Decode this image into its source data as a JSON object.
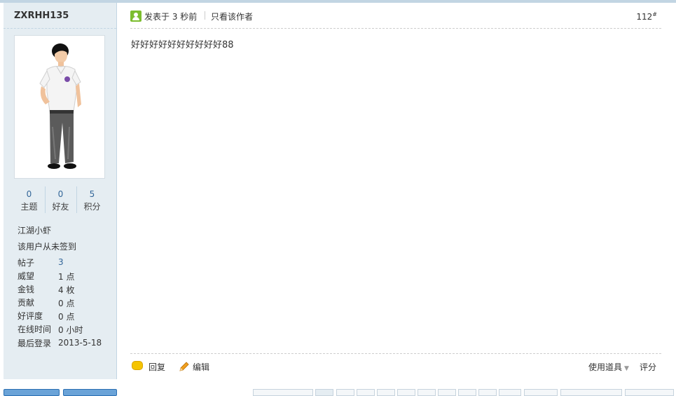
{
  "user": {
    "name": "ZXRHH135",
    "stats": [
      {
        "value": "0",
        "label": "主题"
      },
      {
        "value": "0",
        "label": "好友"
      },
      {
        "value": "5",
        "label": "积分"
      }
    ],
    "rank": "江湖小虾",
    "signin": "该用户从未签到",
    "info": [
      {
        "key": "帖子",
        "value": "3"
      },
      {
        "key": "威望",
        "value": "1 点"
      },
      {
        "key": "金钱",
        "value": "4 枚"
      },
      {
        "key": "贡献",
        "value": "0 点"
      },
      {
        "key": "好评度",
        "value": "0 点"
      },
      {
        "key": "在线时间",
        "value": "0 小时"
      },
      {
        "key": "最后登录",
        "value": "2013-5-18"
      }
    ]
  },
  "post": {
    "posted": "发表于 3 秒前",
    "only_author": "只看该作者",
    "floor": "112",
    "floor_mark": "#",
    "content": "好好好好好好好好好好88"
  },
  "actions": {
    "reply": "回复",
    "edit": "编辑",
    "tools": "使用道具",
    "rate": "评分"
  },
  "colors": {
    "sidebar_bg": "#e5edf2",
    "border": "#c2d5e3",
    "link": "#336699"
  },
  "icons": {
    "posted": "user-icon",
    "reply": "speech-bubble-icon",
    "edit": "pencil-icon"
  }
}
